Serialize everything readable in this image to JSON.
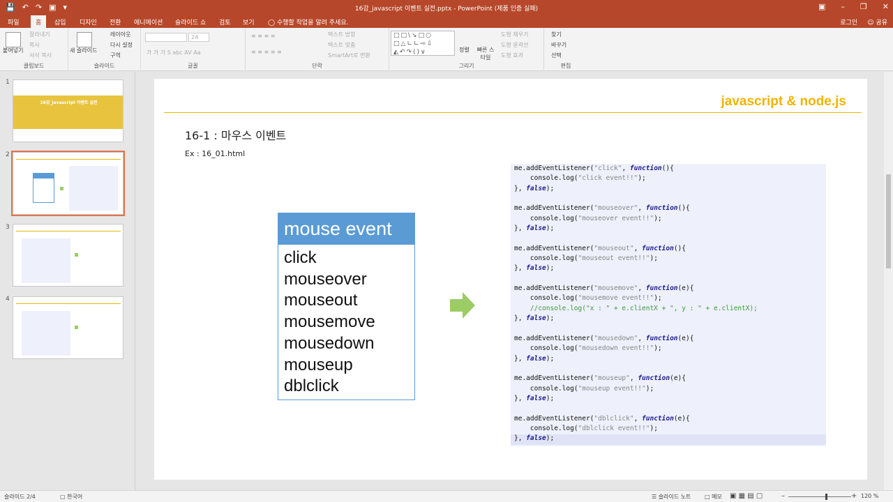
{
  "window": {
    "title": "16강_javascript 이벤트 실전.pptx - PowerPoint (제품 인증 실패)",
    "qat_icons": [
      "save-icon",
      "undo-icon",
      "redo-icon",
      "present-icon",
      "customize-icon"
    ]
  },
  "tabs": [
    "파일",
    "홈",
    "삽입",
    "디자인",
    "전환",
    "애니메이션",
    "슬라이드 쇼",
    "검토",
    "보기"
  ],
  "active_tab": "홈",
  "tell_me": "수행할 작업을 알려 주세요.",
  "account": {
    "login": "로그인",
    "share": "공유"
  },
  "ribbon": {
    "clipboard": {
      "label": "클립보드",
      "paste": "붙여넣기",
      "cut": "잘라내기",
      "copy": "복사",
      "format_painter": "서식 복사"
    },
    "slides": {
      "label": "슬라이드",
      "new_slide": "새 슬라이드",
      "layout": "레이아웃",
      "reset": "다시 설정",
      "section": "구역"
    },
    "font": {
      "label": "글꼴",
      "size": "24"
    },
    "paragraph": {
      "label": "단락",
      "text_direction": "텍스트 방향",
      "align_text": "텍스트 맞춤",
      "smartart": "SmartArt로 변환"
    },
    "drawing": {
      "label": "그리기",
      "arrange": "정렬",
      "quick_styles": "빠른 스타일",
      "shape_fill": "도형 채우기",
      "shape_outline": "도형 윤곽선",
      "shape_effects": "도형 효과"
    },
    "editing": {
      "label": "편집",
      "find": "찾기",
      "replace": "바꾸기",
      "select": "선택"
    }
  },
  "thumbnails": [
    "1",
    "2",
    "3",
    "4"
  ],
  "thumbnail_1_title": "16강_javascript 이벤트 실전",
  "slide": {
    "header": "javascript & node.js",
    "title": "16-1 : 마우스 이벤트",
    "subtitle": "Ex : 16_01.html",
    "event_box": {
      "heading": "mouse event",
      "items": [
        "click",
        "mouseover",
        "mouseout",
        "mousemove",
        "mousedown",
        "mouseup",
        "dblclick"
      ]
    },
    "code_blocks": [
      {
        "event": "click",
        "param": "()",
        "log": "click event!!"
      },
      {
        "event": "mouseover",
        "param": "()",
        "log": "mouseover event!!"
      },
      {
        "event": "mouseout",
        "param": "()",
        "log": "mouseout event!!"
      },
      {
        "event": "mousemove",
        "param": "(e)",
        "log": "mousemove event!!",
        "comment": "//console.log(\"x : \" + e.clientX + \", y : \" + e.clientX);"
      },
      {
        "event": "mousedown",
        "param": "(e)",
        "log": "mousedown event!!"
      },
      {
        "event": "mouseup",
        "param": "(e)",
        "log": "mouseup event!!"
      },
      {
        "event": "dblclick",
        "param": "(e)",
        "log": "dblclick event!!"
      }
    ]
  },
  "status": {
    "slide_info": "슬라이드 2/4",
    "language": "한국어",
    "notes": "슬라이드 노트",
    "comments": "메모",
    "zoom": "120 %"
  },
  "colors": {
    "accent": "#b7472a",
    "slide_header": "#f0b400",
    "event_box": "#5b9bd5",
    "arrow": "#9ccc65"
  }
}
